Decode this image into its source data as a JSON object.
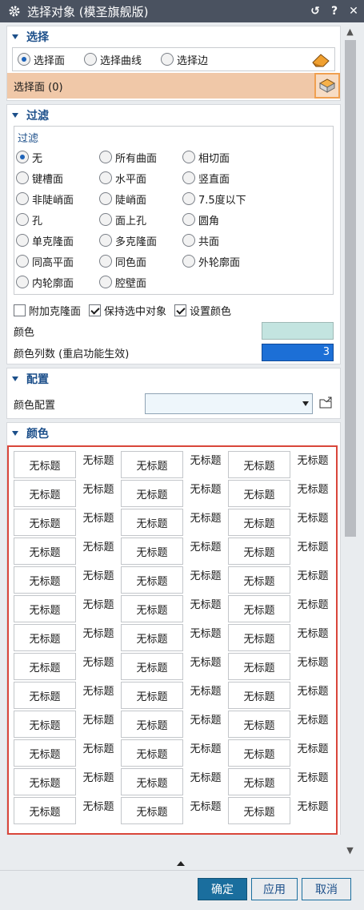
{
  "window": {
    "title": "选择对象 (模圣旗舰版)",
    "buttons": {
      "reset": "↺",
      "help": "?",
      "close": "✕"
    }
  },
  "selection": {
    "header": "选择",
    "radios": [
      {
        "label": "选择面",
        "checked": true
      },
      {
        "label": "选择曲线",
        "checked": false
      },
      {
        "label": "选择边",
        "checked": false
      }
    ],
    "selected_label": "选择面 (0)",
    "icon": "select-face-icon"
  },
  "filter": {
    "header": "过滤",
    "group_title": "过滤",
    "radios": [
      {
        "label": "无",
        "checked": true
      },
      {
        "label": "所有曲面",
        "checked": false
      },
      {
        "label": "相切面",
        "checked": false
      },
      {
        "label": "键槽面",
        "checked": false
      },
      {
        "label": "水平面",
        "checked": false
      },
      {
        "label": "竖直面",
        "checked": false
      },
      {
        "label": "非陡峭面",
        "checked": false
      },
      {
        "label": "陡峭面",
        "checked": false
      },
      {
        "label": "7.5度以下",
        "checked": false
      },
      {
        "label": "孔",
        "checked": false
      },
      {
        "label": "面上孔",
        "checked": false
      },
      {
        "label": "圆角",
        "checked": false
      },
      {
        "label": "单克隆面",
        "checked": false
      },
      {
        "label": "多克隆面",
        "checked": false
      },
      {
        "label": "共面",
        "checked": false
      },
      {
        "label": "同高平面",
        "checked": false
      },
      {
        "label": "同色面",
        "checked": false
      },
      {
        "label": "外轮廓面",
        "checked": false
      },
      {
        "label": "内轮廓面",
        "checked": false
      },
      {
        "label": "腔壁面",
        "checked": false
      }
    ],
    "checkboxes": [
      {
        "label": "附加克隆面",
        "checked": false
      },
      {
        "label": "保持选中对象",
        "checked": true
      },
      {
        "label": "设置颜色",
        "checked": true
      }
    ],
    "color_label": "颜色",
    "color_value": "#c3e4e0",
    "columns_label": "颜色列数 (重启功能生效)",
    "columns_value": "3"
  },
  "config": {
    "header": "配置",
    "color_config_label": "颜色配置",
    "color_config_value": ""
  },
  "colors": {
    "header": "颜色",
    "swatch_label": "无标题",
    "rows": 13
  },
  "footer": {
    "ok": "确定",
    "apply": "应用",
    "cancel": "取消"
  },
  "accent": {
    "title_bar": "#4a5260",
    "section": "#1c4f8a",
    "highlight": "#f0c8a8",
    "palette_border": "#d9463a"
  }
}
